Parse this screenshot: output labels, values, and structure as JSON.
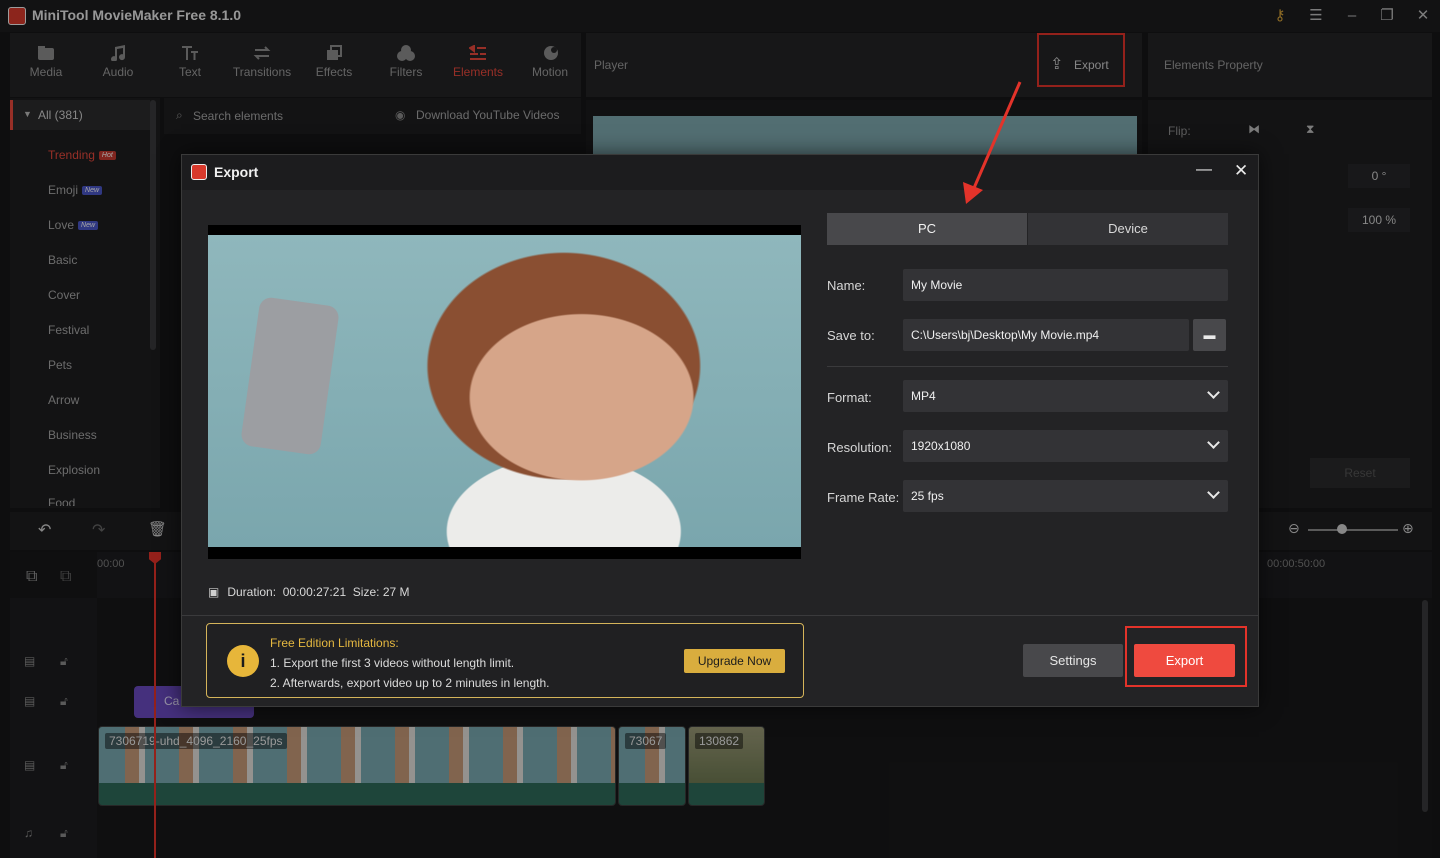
{
  "app": {
    "title": "MiniTool MovieMaker Free 8.1.0"
  },
  "tools": [
    {
      "label": "Media",
      "icon": "media-icon"
    },
    {
      "label": "Audio",
      "icon": "audio-icon"
    },
    {
      "label": "Text",
      "icon": "text-icon"
    },
    {
      "label": "Transitions",
      "icon": "transitions-icon"
    },
    {
      "label": "Effects",
      "icon": "effects-icon"
    },
    {
      "label": "Filters",
      "icon": "filters-icon"
    },
    {
      "label": "Elements",
      "icon": "elements-icon",
      "active": true
    },
    {
      "label": "Motion",
      "icon": "motion-icon"
    }
  ],
  "library": {
    "all": "All (381)",
    "items": [
      "Trending",
      "Emoji",
      "Love",
      "Basic",
      "Cover",
      "Festival",
      "Pets",
      "Arrow",
      "Business",
      "Explosion",
      "Food"
    ],
    "badges": {
      "hot": "Hot",
      "new": "New"
    }
  },
  "search": {
    "placeholder": "Search elements",
    "download": "Download YouTube Videos"
  },
  "player": {
    "title": "Player",
    "export_label": "Export"
  },
  "properties": {
    "title": "Elements Property",
    "flip_label": "Flip:",
    "rotation": "0 °",
    "opacity": "100 %",
    "reset": "Reset"
  },
  "timeline": {
    "time_start": "00:00",
    "time_end": "00:00:50:00",
    "caption_clip": "Ca",
    "clips": [
      "7306719-uhd_4096_2160_25fps",
      "73067",
      "130862"
    ]
  },
  "export_dialog": {
    "title": "Export",
    "tab_pc": "PC",
    "tab_device": "Device",
    "name_label": "Name:",
    "name_value": "My Movie",
    "save_label": "Save to:",
    "save_value": "C:\\Users\\bj\\Desktop\\My Movie.mp4",
    "format_label": "Format:",
    "format_value": "MP4",
    "resolution_label": "Resolution:",
    "resolution_value": "1920x1080",
    "framerate_label": "Frame Rate:",
    "framerate_value": "25 fps",
    "duration_label": "Duration:",
    "duration_value": "00:00:27:21",
    "size_label": "Size:",
    "size_value": "27 M",
    "limit_title": "Free Edition Limitations:",
    "limit_line1": "1. Export the first 3 videos without length limit.",
    "limit_line2": "2. Afterwards, export video up to 2 minutes in length.",
    "upgrade_label": "Upgrade Now",
    "settings_label": "Settings",
    "export_label": "Export"
  },
  "colors": {
    "accent": "#e9493d",
    "highlight": "#e3332a",
    "gold": "#d9ad3e"
  }
}
